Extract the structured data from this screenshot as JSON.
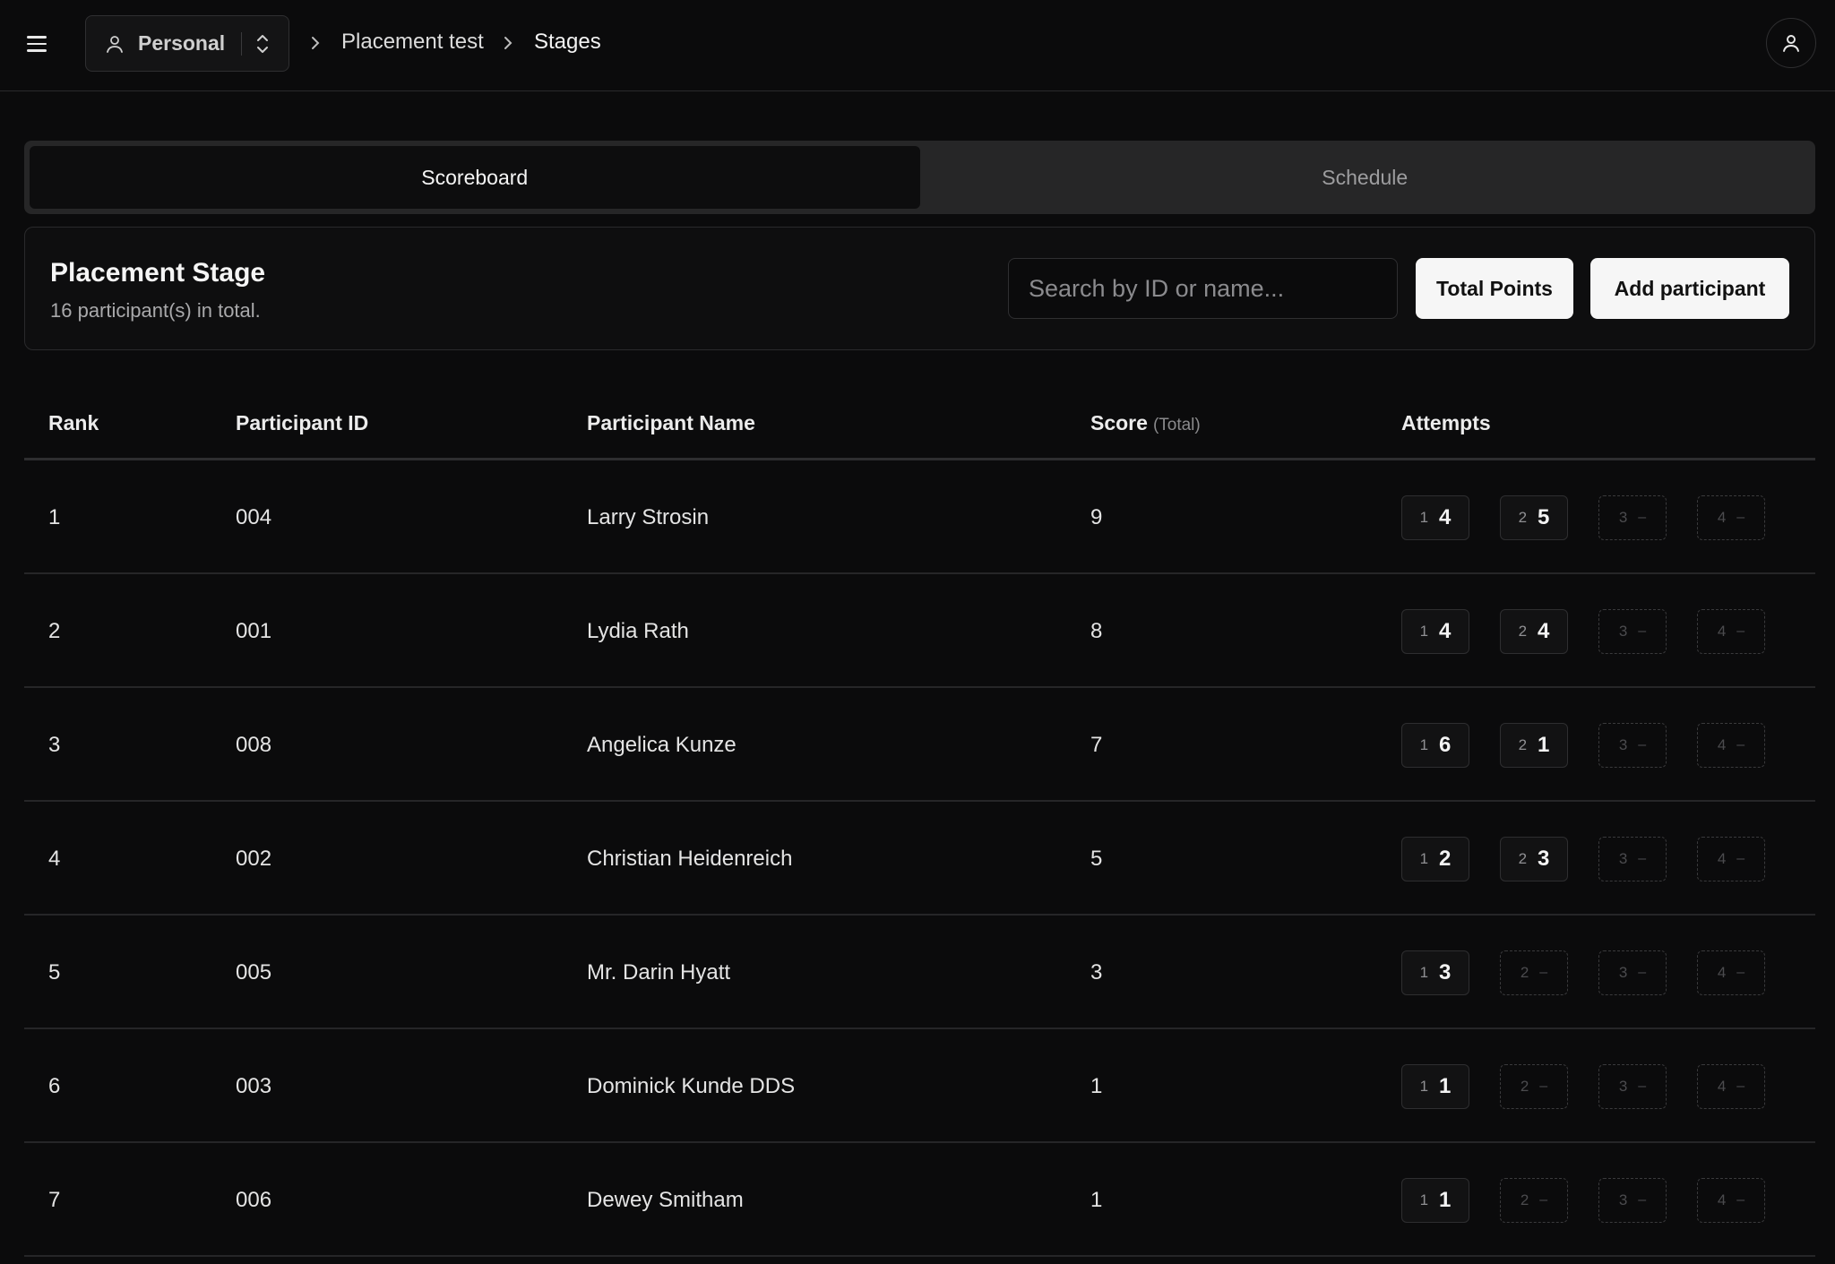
{
  "header": {
    "workspace_label": "Personal",
    "breadcrumbs": [
      "Placement test",
      "Stages"
    ]
  },
  "tabs": [
    {
      "label": "Scoreboard",
      "active": true
    },
    {
      "label": "Schedule",
      "active": false
    }
  ],
  "stage": {
    "title": "Placement Stage",
    "subtitle": "16 participant(s) in total.",
    "search_placeholder": "Search by ID or name...",
    "total_points_label": "Total Points",
    "add_participant_label": "Add participant"
  },
  "table": {
    "headers": {
      "rank": "Rank",
      "id": "Participant ID",
      "name": "Participant Name",
      "score": "Score",
      "score_note": "(Total)",
      "attempts": "Attempts"
    },
    "empty_attempt": "–",
    "rows": [
      {
        "rank": "1",
        "id": "004",
        "name": "Larry Strosin",
        "score": "9",
        "attempts": [
          "4",
          "5",
          null,
          null
        ]
      },
      {
        "rank": "2",
        "id": "001",
        "name": "Lydia Rath",
        "score": "8",
        "attempts": [
          "4",
          "4",
          null,
          null
        ]
      },
      {
        "rank": "3",
        "id": "008",
        "name": "Angelica Kunze",
        "score": "7",
        "attempts": [
          "6",
          "1",
          null,
          null
        ]
      },
      {
        "rank": "4",
        "id": "002",
        "name": "Christian Heidenreich",
        "score": "5",
        "attempts": [
          "2",
          "3",
          null,
          null
        ]
      },
      {
        "rank": "5",
        "id": "005",
        "name": "Mr. Darin Hyatt",
        "score": "3",
        "attempts": [
          "3",
          null,
          null,
          null
        ]
      },
      {
        "rank": "6",
        "id": "003",
        "name": "Dominick Kunde DDS",
        "score": "1",
        "attempts": [
          "1",
          null,
          null,
          null
        ]
      },
      {
        "rank": "7",
        "id": "006",
        "name": "Dewey Smitham",
        "score": "1",
        "attempts": [
          "1",
          null,
          null,
          null
        ]
      }
    ]
  }
}
